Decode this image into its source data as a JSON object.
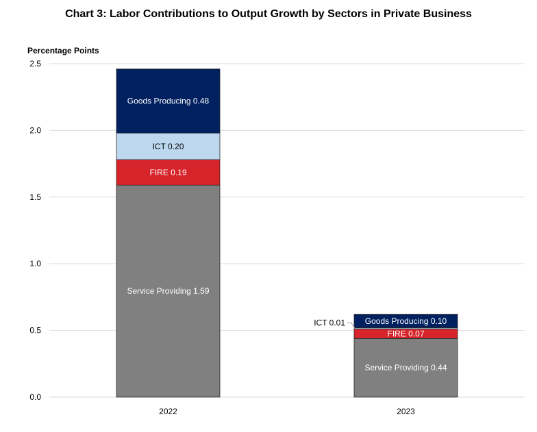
{
  "chart_data": {
    "type": "bar",
    "stacked": true,
    "title": "Chart 3: Labor Contributions to Output Growth by Sectors in Private Business",
    "ylabel": "Percentage Points",
    "xlabel": "",
    "ylim": [
      0,
      2.5
    ],
    "yticks": [
      "0.0",
      "0.5",
      "1.0",
      "1.5",
      "2.0",
      "2.5"
    ],
    "ytick_values": [
      0,
      0.5,
      1.0,
      1.5,
      2.0,
      2.5
    ],
    "grid": true,
    "legend": "none",
    "categories": [
      "2022",
      "2023"
    ],
    "series": [
      {
        "name": "Service Providing",
        "color": "#808080",
        "label_color": "#ffffff",
        "values": [
          1.59,
          0.44
        ],
        "labels": [
          "Service Providing 1.59",
          "Service Providing 0.44"
        ]
      },
      {
        "name": "FIRE",
        "color": "#d7242b",
        "label_color": "#ffffff",
        "values": [
          0.19,
          0.07
        ],
        "labels": [
          "FIRE 0.19",
          "FIRE 0.07"
        ]
      },
      {
        "name": "ICT",
        "color": "#bdd7ee",
        "label_color": "#000000",
        "values": [
          0.2,
          0.01
        ],
        "labels": [
          "ICT 0.20",
          "ICT 0.01"
        ]
      },
      {
        "name": "Goods Producing",
        "color": "#002060",
        "label_color": "#ffffff",
        "values": [
          0.48,
          0.1
        ],
        "labels": [
          "Goods Producing 0.48",
          "Goods Producing 0.10"
        ]
      }
    ]
  }
}
